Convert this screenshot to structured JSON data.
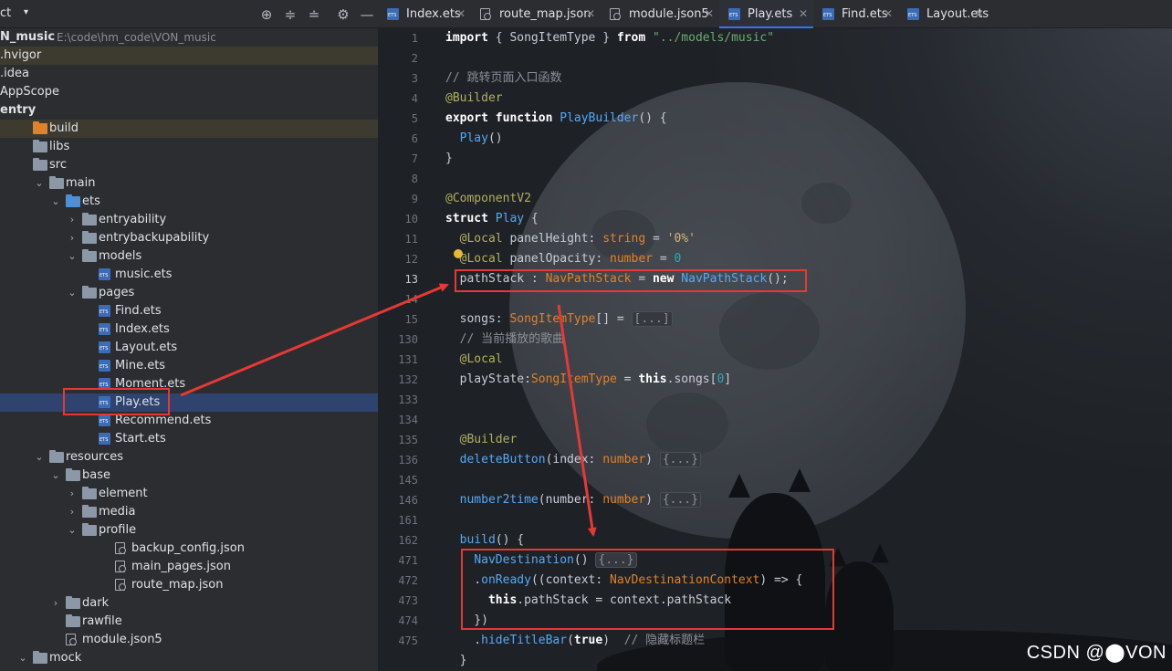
{
  "panel": {
    "title": "ct",
    "caret": "▾",
    "tools": {
      "locate": "⊕",
      "expand": "≑",
      "collapse": "≐",
      "settings": "⚙",
      "hide": "—"
    }
  },
  "tree": [
    {
      "label": "N_music",
      "hint": "E:\\code\\hm_code\\VON_music",
      "bold": true,
      "indent": 0,
      "icon": "none",
      "chev": ""
    },
    {
      "label": ".hvigor",
      "indent": 0,
      "icon": "none",
      "chev": "",
      "hl": true
    },
    {
      "label": ".idea",
      "indent": 0,
      "icon": "none",
      "chev": ""
    },
    {
      "label": "AppScope",
      "indent": 0,
      "icon": "none",
      "chev": ""
    },
    {
      "label": "entry",
      "bold": true,
      "indent": 0,
      "icon": "none",
      "chev": ""
    },
    {
      "label": "build",
      "indent": 18,
      "icon": "folder-orange",
      "chev": "",
      "hl": true
    },
    {
      "label": "libs",
      "indent": 18,
      "icon": "folder",
      "chev": ""
    },
    {
      "label": "src",
      "indent": 18,
      "icon": "folder",
      "chev": ""
    },
    {
      "label": "main",
      "indent": 36,
      "icon": "folder",
      "chev": "⌄"
    },
    {
      "label": "ets",
      "indent": 54,
      "icon": "folder-blue",
      "chev": "⌄"
    },
    {
      "label": "entryability",
      "indent": 72,
      "icon": "folder",
      "chev": "›"
    },
    {
      "label": "entrybackupability",
      "indent": 72,
      "icon": "folder",
      "chev": "›"
    },
    {
      "label": "models",
      "indent": 72,
      "icon": "folder",
      "chev": "⌄"
    },
    {
      "label": "music.ets",
      "indent": 90,
      "icon": "ets",
      "chev": ""
    },
    {
      "label": "pages",
      "indent": 72,
      "icon": "folder",
      "chev": "⌄"
    },
    {
      "label": "Find.ets",
      "indent": 90,
      "icon": "ets",
      "chev": ""
    },
    {
      "label": "Index.ets",
      "indent": 90,
      "icon": "ets",
      "chev": ""
    },
    {
      "label": "Layout.ets",
      "indent": 90,
      "icon": "ets",
      "chev": ""
    },
    {
      "label": "Mine.ets",
      "indent": 90,
      "icon": "ets",
      "chev": ""
    },
    {
      "label": "Moment.ets",
      "indent": 90,
      "icon": "ets",
      "chev": ""
    },
    {
      "label": "Play.ets",
      "indent": 90,
      "icon": "ets",
      "chev": "",
      "sel": true
    },
    {
      "label": "Recommend.ets",
      "indent": 90,
      "icon": "ets",
      "chev": ""
    },
    {
      "label": "Start.ets",
      "indent": 90,
      "icon": "ets",
      "chev": ""
    },
    {
      "label": "resources",
      "indent": 36,
      "icon": "folder",
      "chev": "⌄"
    },
    {
      "label": "base",
      "indent": 54,
      "icon": "folder",
      "chev": "⌄"
    },
    {
      "label": "element",
      "indent": 72,
      "icon": "folder",
      "chev": "›"
    },
    {
      "label": "media",
      "indent": 72,
      "icon": "folder",
      "chev": "›"
    },
    {
      "label": "profile",
      "indent": 72,
      "icon": "folder",
      "chev": "⌄"
    },
    {
      "label": "backup_config.json",
      "indent": 108,
      "icon": "json",
      "chev": ""
    },
    {
      "label": "main_pages.json",
      "indent": 108,
      "icon": "json",
      "chev": ""
    },
    {
      "label": "route_map.json",
      "indent": 108,
      "icon": "json",
      "chev": ""
    },
    {
      "label": "dark",
      "indent": 54,
      "icon": "folder",
      "chev": "›"
    },
    {
      "label": "rawfile",
      "indent": 54,
      "icon": "folder",
      "chev": ""
    },
    {
      "label": "module.json5",
      "indent": 54,
      "icon": "json",
      "chev": ""
    },
    {
      "label": "mock",
      "indent": 18,
      "icon": "folder",
      "chev": "⌄"
    }
  ],
  "tabs": [
    {
      "label": "Index.ets",
      "icon": "ets",
      "close": "✕"
    },
    {
      "label": "route_map.json",
      "icon": "json",
      "close": "✕"
    },
    {
      "label": "module.json5",
      "icon": "json",
      "close": "✕"
    },
    {
      "label": "Play.ets",
      "icon": "ets",
      "close": "✕",
      "active": true
    },
    {
      "label": "Find.ets",
      "icon": "ets",
      "close": "✕"
    },
    {
      "label": "Layout.ets",
      "icon": "ets",
      "close": "✕"
    }
  ],
  "line_numbers": [
    "1",
    "2",
    "3",
    "4",
    "5",
    "6",
    "7",
    "8",
    "9",
    "10",
    "11",
    "12",
    "13",
    "14",
    "15",
    "130",
    "131",
    "132",
    "133",
    "134",
    "135",
    "136",
    "145",
    "146",
    "161",
    "162",
    "471",
    "472",
    "473",
    "474",
    "475"
  ],
  "current_line": "13",
  "code": [
    [
      [
        "kw",
        "import"
      ],
      [
        "pl",
        " { SongItemType } "
      ],
      [
        "kw",
        "from"
      ],
      [
        "pl",
        " "
      ],
      [
        "str",
        "\"../models/music\""
      ]
    ],
    [],
    [
      [
        "cm",
        "// 跳转页面入口函数"
      ]
    ],
    [
      [
        "an",
        "@Builder"
      ]
    ],
    [
      [
        "kw",
        "export function"
      ],
      [
        "pl",
        " "
      ],
      [
        "fn",
        "PlayBuilder"
      ],
      [
        "pl",
        "() {"
      ]
    ],
    [
      [
        "pl",
        "  "
      ],
      [
        "fn",
        "Play"
      ],
      [
        "pl",
        "()"
      ]
    ],
    [
      [
        "pl",
        "}"
      ]
    ],
    [],
    [
      [
        "an",
        "@ComponentV2"
      ]
    ],
    [
      [
        "kw",
        "struct"
      ],
      [
        "pl",
        " "
      ],
      [
        "tyb",
        "Play"
      ],
      [
        "pl",
        " {"
      ]
    ],
    [
      [
        "pl",
        "  "
      ],
      [
        "an",
        "@Local"
      ],
      [
        "pl",
        " panelHeight: "
      ],
      [
        "ty",
        "string"
      ],
      [
        "pl",
        " = "
      ],
      [
        "strp",
        "'0%'"
      ]
    ],
    [
      [
        "pl",
        "  "
      ],
      [
        "an",
        "@Local"
      ],
      [
        "pl",
        " panelOpacity: "
      ],
      [
        "ty",
        "number"
      ],
      [
        "pl",
        " = "
      ],
      [
        "num",
        "0"
      ]
    ],
    [
      [
        "pl",
        "  pathStack : "
      ],
      [
        "ty",
        "NavPathStack"
      ],
      [
        "pl",
        " = "
      ],
      [
        "kw",
        "new"
      ],
      [
        "pl",
        " "
      ],
      [
        "tyb",
        "NavPathStack"
      ],
      [
        "pl",
        "();"
      ]
    ],
    [],
    [
      [
        "pl",
        "  songs: "
      ],
      [
        "ty",
        "SongItemType"
      ],
      [
        "pl",
        "[] = "
      ],
      [
        "fold",
        "[...]"
      ]
    ],
    [
      [
        "pl",
        "  "
      ],
      [
        "cm",
        "// 当前播放的歌曲"
      ]
    ],
    [
      [
        "pl",
        "  "
      ],
      [
        "an",
        "@Local"
      ]
    ],
    [
      [
        "pl",
        "  playState:"
      ],
      [
        "ty",
        "SongItemType"
      ],
      [
        "pl",
        " = "
      ],
      [
        "kw",
        "this"
      ],
      [
        "pl",
        ".songs["
      ],
      [
        "num",
        "0"
      ],
      [
        "pl",
        "]"
      ]
    ],
    [],
    [],
    [
      [
        "pl",
        "  "
      ],
      [
        "an",
        "@Builder"
      ]
    ],
    [
      [
        "pl",
        "  "
      ],
      [
        "fn",
        "deleteButton"
      ],
      [
        "pl",
        "(index: "
      ],
      [
        "ty",
        "number"
      ],
      [
        "pl",
        ") "
      ],
      [
        "fold",
        "{...}"
      ]
    ],
    [],
    [
      [
        "pl",
        "  "
      ],
      [
        "fn",
        "number2time"
      ],
      [
        "pl",
        "(number: "
      ],
      [
        "ty",
        "number"
      ],
      [
        "pl",
        ") "
      ],
      [
        "fold",
        "{...}"
      ]
    ],
    [],
    [
      [
        "pl",
        "  "
      ],
      [
        "fn",
        "build"
      ],
      [
        "pl",
        "() {"
      ]
    ],
    [
      [
        "pl",
        "    "
      ],
      [
        "fn",
        "NavDestination"
      ],
      [
        "pl",
        "() "
      ],
      [
        "fold",
        "{...}"
      ]
    ],
    [
      [
        "pl",
        "    ."
      ],
      [
        "fn",
        "onReady"
      ],
      [
        "pl",
        "((context: "
      ],
      [
        "ty",
        "NavDestinationContext"
      ],
      [
        "pl",
        ") => {"
      ]
    ],
    [
      [
        "pl",
        "      "
      ],
      [
        "kw",
        "this"
      ],
      [
        "pl",
        ".pathStack = context.pathStack"
      ]
    ],
    [
      [
        "pl",
        "    })"
      ]
    ],
    [
      [
        "pl",
        "    ."
      ],
      [
        "fn",
        "hideTitleBar"
      ],
      [
        "pl",
        "("
      ],
      [
        "kw",
        "true"
      ],
      [
        "pl",
        ")  "
      ],
      [
        "cm",
        "// 隐藏标题栏"
      ]
    ],
    [
      [
        "pl",
        "  }"
      ]
    ]
  ],
  "watermark": "CSDN @⬤VON",
  "colors": {
    "accent": "#3574f0",
    "annotation_red": "#e53935",
    "keyword": "#ffffff",
    "function": "#56a8f5",
    "type": "#e0822b",
    "comment": "#8c9097"
  }
}
